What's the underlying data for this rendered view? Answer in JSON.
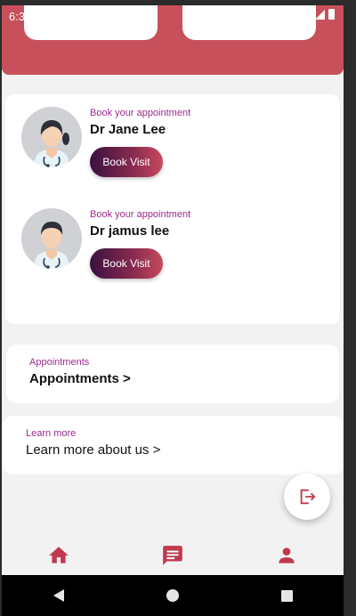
{
  "status_bar": {
    "time": "6:3"
  },
  "doctors": [
    {
      "subtitle": "Book your appointment",
      "name": "Dr Jane Lee",
      "button": "Book Visit",
      "avatar": "female-doctor"
    },
    {
      "subtitle": "Book your appointment",
      "name": "Dr jamus lee",
      "button": "Book Visit",
      "avatar": "male-doctor"
    }
  ],
  "appointments_card": {
    "subtitle": "Appointments",
    "title": "Appointments >"
  },
  "learn_card": {
    "subtitle": "Learn more",
    "title": "Learn more about us >"
  },
  "fab": {
    "icon": "logout-icon"
  },
  "bottom_nav": {
    "items": [
      "home-icon",
      "chat-icon",
      "person-icon"
    ]
  },
  "system_nav": {
    "items": [
      "back",
      "home",
      "recents"
    ]
  },
  "colors": {
    "accent": "#c8505a",
    "purple_text": "#9c2a8c",
    "icon_red": "#c0394e"
  }
}
